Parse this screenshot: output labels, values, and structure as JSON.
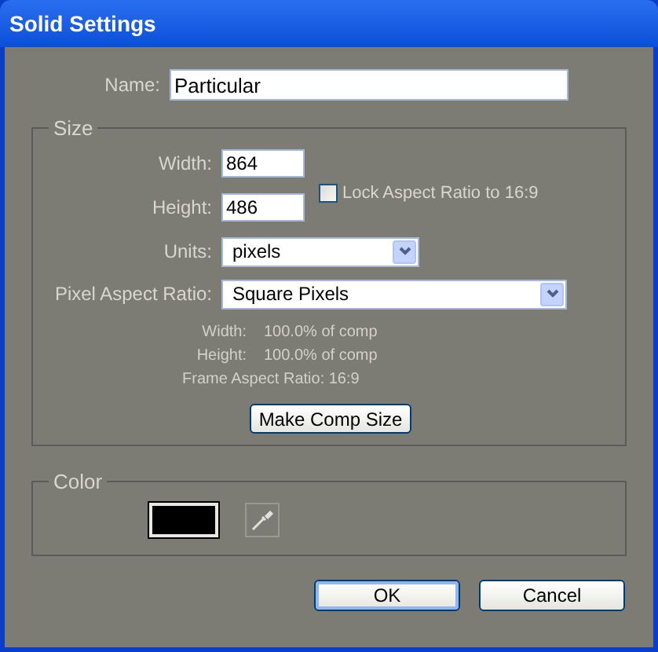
{
  "window": {
    "title": "Solid Settings"
  },
  "name": {
    "label": "Name:",
    "value": "Particular"
  },
  "size": {
    "legend": "Size",
    "width": {
      "label": "Width:",
      "value": "864"
    },
    "height": {
      "label": "Height:",
      "value": "486"
    },
    "lock": {
      "label": "Lock Aspect Ratio to 16:9",
      "checked": false
    },
    "units": {
      "label": "Units:",
      "value": "pixels"
    },
    "pixel_aspect_ratio": {
      "label": "Pixel Aspect Ratio:",
      "value": "Square Pixels"
    },
    "info": [
      {
        "kind": "pair",
        "label": "Width:",
        "value": "100.0% of comp"
      },
      {
        "kind": "pair",
        "label": "Height:",
        "value": "100.0% of comp"
      },
      {
        "kind": "line",
        "text": "Frame Aspect Ratio: 16:9"
      }
    ],
    "make_comp_size": "Make Comp Size"
  },
  "color": {
    "legend": "Color",
    "color": "#000000"
  },
  "buttons": [
    {
      "label": "OK",
      "default": true
    },
    {
      "label": "Cancel",
      "default": false
    }
  ]
}
